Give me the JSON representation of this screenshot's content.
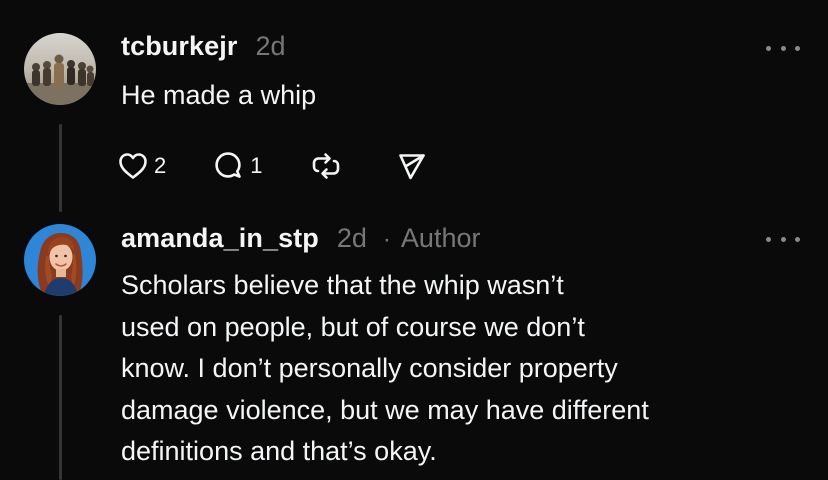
{
  "comments": [
    {
      "username": "tcburkejr",
      "time": "2d",
      "text": "He made a whip",
      "actions": {
        "likes": "2",
        "replies": "1"
      },
      "avatar_icon": "group-photo-avatar"
    },
    {
      "username": "amanda_in_stp",
      "time": "2d",
      "separator": "·",
      "badge": "Author",
      "lines": [
        "Scholars believe that the whip wasn’t",
        "used on people, but of course we don’t",
        "know. I don’t personally consider property",
        "damage violence, but we may have different",
        "definitions and that’s okay."
      ],
      "avatar_icon": "woman-portrait-avatar"
    }
  ],
  "colors": {
    "background": "#0a0a0a",
    "primary_text": "#f3f5f7",
    "secondary_text": "#777777",
    "avatar_ring_blue": "#2f86d6"
  },
  "icons": [
    "heart-icon",
    "comment-icon",
    "repost-icon",
    "share-icon",
    "more-options-icon"
  ]
}
